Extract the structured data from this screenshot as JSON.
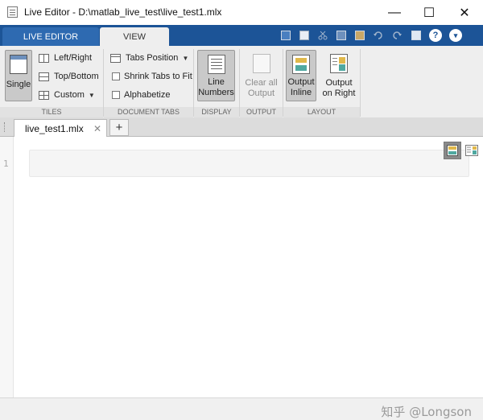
{
  "window": {
    "title": "Live Editor - D:\\matlab_live_test\\live_test1.mlx",
    "minimize_glyph": "—",
    "maximize_glyph": "☐",
    "close_glyph": "✕"
  },
  "ribbon_tabs": [
    {
      "label": "LIVE EDITOR",
      "active": false
    },
    {
      "label": "VIEW",
      "active": true
    }
  ],
  "quick_access": {
    "icons": [
      "dock-icon",
      "save-icon",
      "cut-icon",
      "copy-icon",
      "paste-icon",
      "undo-icon",
      "redo-icon",
      "window-icon",
      "help-icon",
      "options-icon"
    ],
    "help_glyph": "?",
    "options_glyph": "▾"
  },
  "sections": {
    "tiles": {
      "label": "TILES",
      "single": "Single",
      "left_right": "Left/Right",
      "top_bottom": "Top/Bottom",
      "custom": "Custom"
    },
    "document_tabs": {
      "label": "DOCUMENT TABS",
      "tabs_position": "Tabs Position",
      "shrink_tabs": "Shrink Tabs to Fit",
      "alphabetize": "Alphabetize"
    },
    "display": {
      "label": "DISPLAY",
      "line_numbers_1": "Line",
      "line_numbers_2": "Numbers"
    },
    "output": {
      "label": "OUTPUT",
      "clear_all_1": "Clear all",
      "clear_all_2": "Output"
    },
    "layout": {
      "label": "LAYOUT",
      "output_inline_1": "Output",
      "output_inline_2": "Inline",
      "output_right_1": "Output",
      "output_right_2": "on Right"
    }
  },
  "document_tabs": [
    {
      "label": "live_test1.mlx",
      "close_glyph": "✕"
    }
  ],
  "add_tab_glyph": "+",
  "editor": {
    "line_numbers": [
      "1"
    ]
  },
  "watermark": "知乎 @Longson",
  "colors": {
    "ribbon_blue": "#1c5497",
    "ribbon_gray": "#eeeeee",
    "selected_button": "#c9c9c9"
  }
}
